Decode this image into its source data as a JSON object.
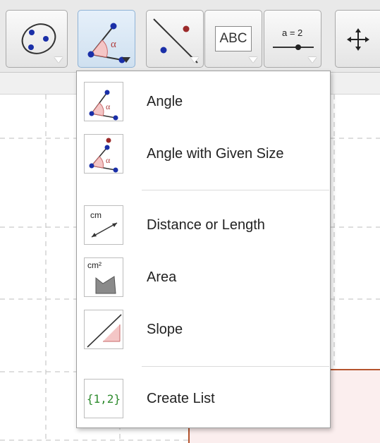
{
  "toolbar": {
    "tools": [
      {
        "name": "conic-tool",
        "icon": "ellipse-through-points-icon"
      },
      {
        "name": "angle-tool",
        "icon": "angle-icon",
        "active": true
      },
      {
        "name": "line-tool",
        "icon": "line-through-points-icon"
      },
      {
        "name": "text-tool",
        "icon": "text-icon",
        "label": "ABC"
      },
      {
        "name": "slider-tool",
        "icon": "slider-icon",
        "label": "a = 2"
      },
      {
        "name": "move-view-tool",
        "icon": "move-cross-icon"
      }
    ]
  },
  "menu": {
    "items": [
      {
        "label": "Angle",
        "icon": "angle-icon"
      },
      {
        "label": "Angle with Given Size",
        "icon": "angle-given-size-icon"
      },
      {
        "label": "Distance or Length",
        "icon": "distance-icon",
        "icon_text": "cm"
      },
      {
        "label": "Area",
        "icon": "area-icon",
        "icon_text": "cm²"
      },
      {
        "label": "Slope",
        "icon": "slope-icon"
      },
      {
        "label": "Create List",
        "icon": "create-list-icon",
        "icon_text": "{1,2}"
      }
    ]
  },
  "colors": {
    "point_blue": "#1a2fa8",
    "point_red": "#9b2a2a",
    "angle_fill": "#f4c6c6",
    "list_green": "#2e8b2e",
    "shape_fill": "#fbeeee",
    "shape_stroke": "#b5542e"
  }
}
